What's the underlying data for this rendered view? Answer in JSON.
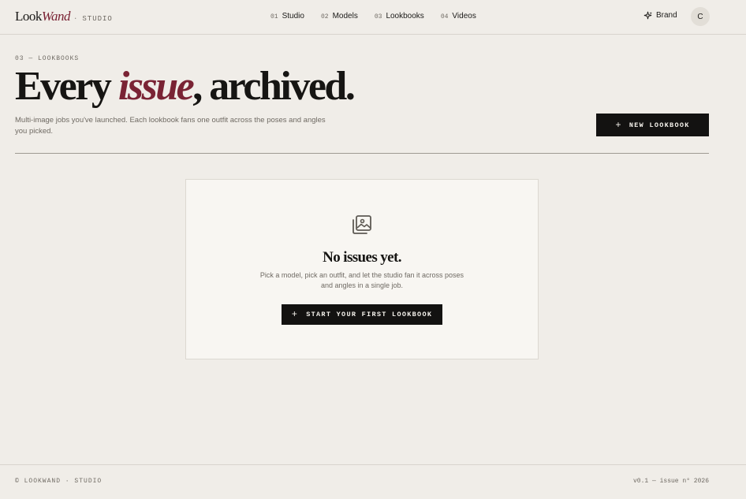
{
  "header": {
    "logo_primary": "Look",
    "logo_accent": "Wand",
    "logo_separator": "·",
    "logo_tag": "STUDIO",
    "nav": [
      {
        "num": "01",
        "label": "Studio"
      },
      {
        "num": "02",
        "label": "Models"
      },
      {
        "num": "03",
        "label": "Lookbooks"
      },
      {
        "num": "04",
        "label": "Videos"
      }
    ],
    "brand_icon": "sparkle-icon",
    "brand_label": "Brand",
    "avatar_initial": "C"
  },
  "hero": {
    "eyebrow": "03 — LOOKBOOKS",
    "title_pre": "Every ",
    "title_accent": "issue",
    "title_post": ", archived.",
    "subtitle": "Multi-image jobs you've launched. Each lookbook fans one outfit across the poses and angles you picked.",
    "new_button_icon": "+",
    "new_button_label": "NEW LOOKBOOK"
  },
  "empty_state": {
    "icon": "image-stack-icon",
    "title": "No issues yet.",
    "text": "Pick a model, pick an outfit, and let the studio fan it across poses and angles in a single job.",
    "button_icon": "+",
    "button_label": "START YOUR FIRST LOOKBOOK"
  },
  "footer": {
    "left": "© LOOKWAND · STUDIO",
    "right": "v0.1 — issue n° 2026"
  },
  "colors": {
    "background": "#f0ede8",
    "accent": "#7a2334",
    "button": "#131211",
    "card": "#f8f6f2"
  }
}
